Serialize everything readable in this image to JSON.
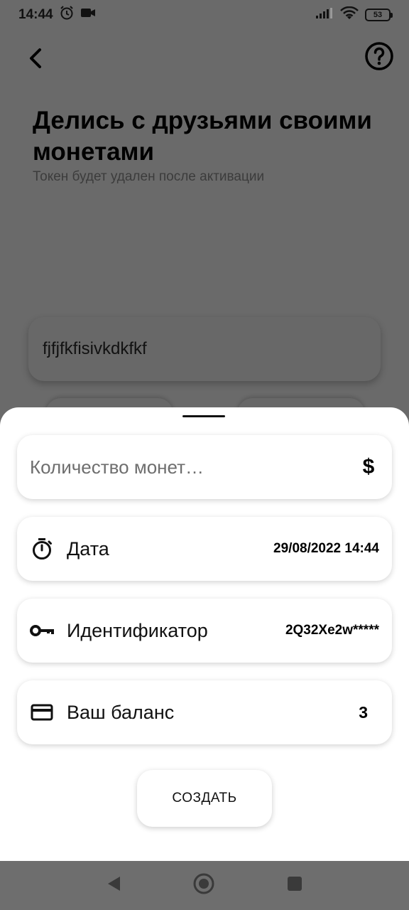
{
  "status_bar": {
    "time": "14:44",
    "battery": "53",
    "icons": [
      "alarm-icon",
      "video-camera-icon",
      "signal-icon",
      "wifi-icon",
      "battery-icon"
    ]
  },
  "header": {
    "back_icon": "chevron-left-icon",
    "help_icon": "help-circle-icon"
  },
  "page": {
    "title": "Делись с друзьями своими монетами",
    "subtitle": "Токен будет удален после активации",
    "token_value": "fjfjfkfisivkdkfkf"
  },
  "sheet": {
    "amount": {
      "placeholder": "Количество монет…",
      "value": "",
      "icon": "dollar-icon",
      "icon_glyph": "$"
    },
    "rows": [
      {
        "icon": "timer-icon",
        "label": "Дата",
        "value": "29/08/2022 14:44"
      },
      {
        "icon": "key-icon",
        "label": "Идентификатор",
        "value": "2Q32Xe2w*****"
      },
      {
        "icon": "credit-card-icon",
        "label": "Ваш баланс",
        "value": "3"
      }
    ],
    "create_label": "СОЗДАТЬ"
  },
  "nav_bar": {
    "icons": [
      "nav-back-icon",
      "nav-home-icon",
      "nav-recents-icon"
    ]
  },
  "colors": {
    "scrim": "#6a6a6a",
    "sheet": "#ffffff",
    "text": "#111111"
  }
}
